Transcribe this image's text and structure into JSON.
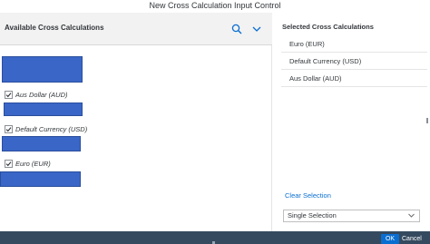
{
  "dialog": {
    "title": "New Cross Calculation Input Control"
  },
  "left": {
    "header_title": "Available Cross Calculations",
    "items": [
      {
        "label": "Aus Dollar (AUD)",
        "checked": true
      },
      {
        "label": "Default Currency (USD)",
        "checked": true
      },
      {
        "label": "Euro (EUR)",
        "checked": true
      }
    ]
  },
  "right": {
    "header_title": "Selected Cross Calculations",
    "items": [
      {
        "label": "Euro (EUR)"
      },
      {
        "label": "Default Currency (USD)"
      },
      {
        "label": "Aus Dollar (AUD)"
      }
    ],
    "clear_label": "Clear Selection",
    "selection_mode": "Single Selection"
  },
  "footer": {
    "ok_label": "OK",
    "cancel_label": "Cancel"
  },
  "colors": {
    "accent": "#0a6ed1",
    "redaction": "#3a66c7",
    "footer": "#354a5f"
  },
  "icons": {
    "search": "search-icon",
    "collapse": "chevron-down-icon",
    "checkbox": "checkmark-icon"
  }
}
